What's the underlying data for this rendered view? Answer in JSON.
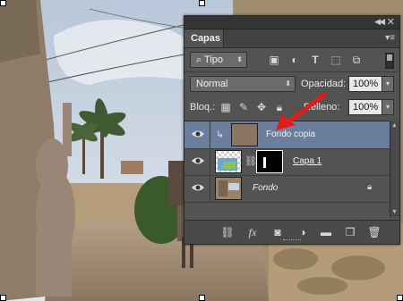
{
  "panel": {
    "tab_label": "Capas",
    "collapse_glyph": "◀◀",
    "close_glyph": "✕",
    "menu_glyph": "▾≡"
  },
  "filter": {
    "kind_label": "Tipo",
    "kind_icon": "search-icon",
    "icons": [
      "image-filter-icon",
      "adjustment-filter-icon",
      "type-filter-icon",
      "shape-filter-icon",
      "smart-object-filter-icon"
    ]
  },
  "blend": {
    "mode": "Normal",
    "opacity_label": "Opacidad:",
    "opacity_value": "100%"
  },
  "lock": {
    "label": "Bloq.:",
    "fill_label": "Relleno:",
    "fill_value": "100%"
  },
  "layers": [
    {
      "name": "Fondo copia",
      "selected": true,
      "clipped": true,
      "thumb_color": "#8a7462",
      "italic": false
    },
    {
      "name": "Capa 1",
      "selected": false,
      "clipped": false,
      "has_mask": true,
      "italic": false
    },
    {
      "name": "Fondo",
      "selected": false,
      "locked": true,
      "italic": true
    }
  ],
  "bottom_icons": [
    "link-icon",
    "fx-icon",
    "add-mask-icon",
    "adjustment-layer-icon",
    "new-group-icon",
    "new-layer-icon",
    "trash-icon"
  ],
  "fx_label": "fx",
  "colors": {
    "panel_bg": "#535353",
    "selected_row": "#6b7f9d",
    "annotation_arrow": "#e11c1c",
    "silhouette": "#9a8676"
  }
}
